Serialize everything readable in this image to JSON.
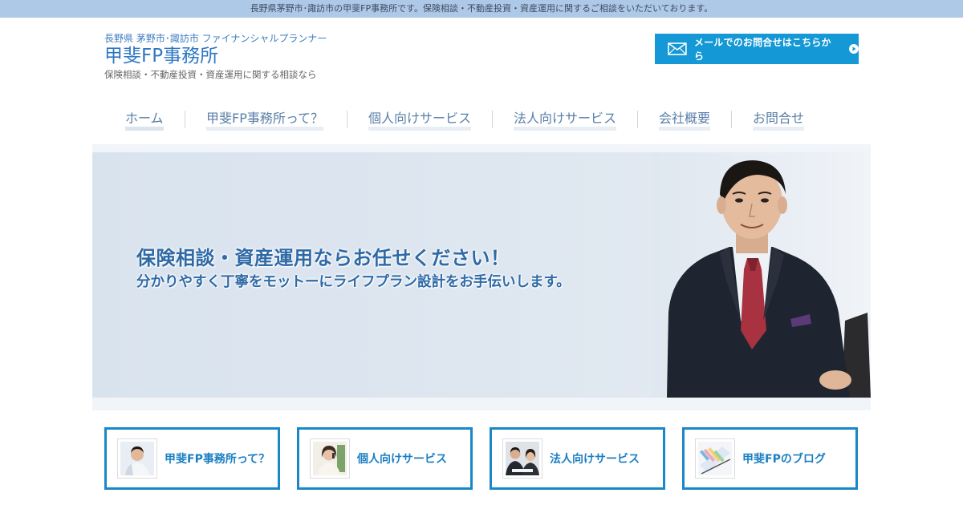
{
  "topbar": {
    "text": "長野県茅野市･諏訪市の甲斐FP事務所です。保険相談・不動産投資・資産運用に関するご相談をいただいております。"
  },
  "header": {
    "tagline": "長野県 茅野市･諏訪市 ファイナンシャルプランナー",
    "title": "甲斐FP事務所",
    "description": "保険相談・不動産投資・資産運用に関する相談なら"
  },
  "mail_button": {
    "label": "メールでのお問合せはこちらから"
  },
  "nav": {
    "items": [
      {
        "label": "ホーム",
        "active": true
      },
      {
        "label": "甲斐FP事務所って？"
      },
      {
        "label": "個人向けサービス"
      },
      {
        "label": "法人向けサービス"
      },
      {
        "label": "会社概要"
      },
      {
        "label": "お問合せ"
      }
    ]
  },
  "hero": {
    "headline": "保険相談・資産運用ならお任せください！",
    "subheadline": "分かりやすく丁寧をモットーにライフプラン設計をお手伝いします。"
  },
  "cards": [
    {
      "label": "甲斐FP事務所って？",
      "icon": "consultant-photo"
    },
    {
      "label": "個人向けサービス",
      "icon": "individual-photo"
    },
    {
      "label": "法人向けサービス",
      "icon": "business-photo"
    },
    {
      "label": "甲斐FPのブログ",
      "icon": "blog-photo"
    }
  ],
  "colors": {
    "topbar": "#aec8e8",
    "accent": "#1598d6",
    "title": "#2f78c2",
    "card_border": "#1b87c9"
  }
}
